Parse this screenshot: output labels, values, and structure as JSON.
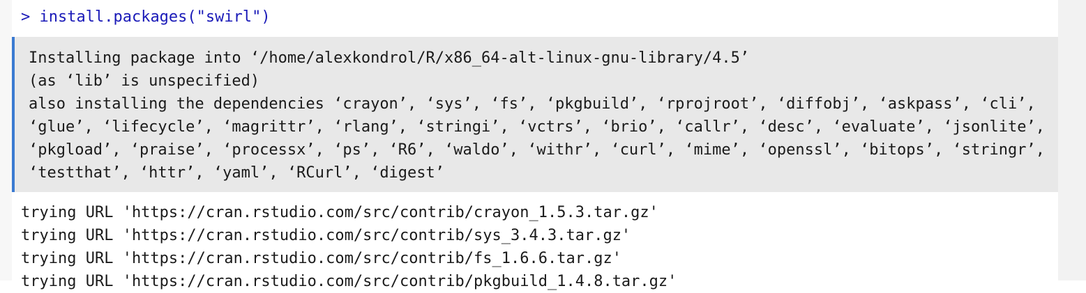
{
  "console": {
    "input": {
      "prompt": "> ",
      "command": "install.packages(\"swirl\")"
    },
    "message_lines": [
      "Installing package into ‘/home/alexkondrol/R/x86_64-alt-linux-gnu-library/4.5’",
      "(as ‘lib’ is unspecified)",
      "also installing the dependencies ‘crayon’, ‘sys’, ‘fs’, ‘pkgbuild’, ‘rprojroot’, ‘diffobj’, ‘askpass’, ‘cli’,",
      "‘glue’, ‘lifecycle’, ‘magrittr’, ‘rlang’, ‘stringi’, ‘vctrs’, ‘brio’, ‘callr’, ‘desc’, ‘evaluate’, ‘jsonlite’,",
      "‘pkgload’, ‘praise’, ‘processx’, ‘ps’, ‘R6’, ‘waldo’, ‘withr’, ‘curl’, ‘mime’, ‘openssl’, ‘bitops’, ‘stringr’,",
      "‘testthat’, ‘httr’, ‘yaml’, ‘RCurl’, ‘digest’"
    ],
    "output_lines": [
      "trying URL 'https://cran.rstudio.com/src/contrib/crayon_1.5.3.tar.gz'",
      "trying URL 'https://cran.rstudio.com/src/contrib/sys_3.4.3.tar.gz'",
      "trying URL 'https://cran.rstudio.com/src/contrib/fs_1.6.6.tar.gz'",
      "trying URL 'https://cran.rstudio.com/src/contrib/pkgbuild_1.4.8.tar.gz'"
    ]
  },
  "colors": {
    "input_text": "#1a1ab8",
    "message_background": "#e8e8e8",
    "message_border": "#3b7ad1"
  }
}
